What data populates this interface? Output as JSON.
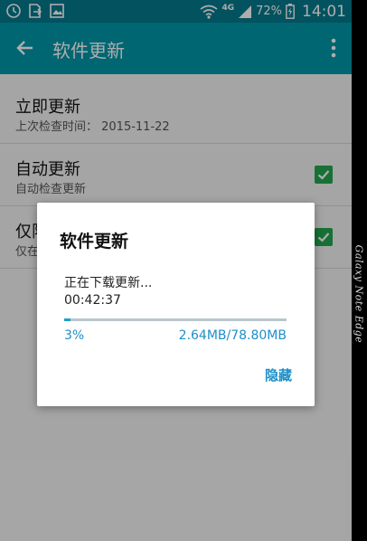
{
  "status_bar": {
    "icons": [
      "clock-icon",
      "export-icon",
      "image-icon",
      "wifi-icon",
      "signal-icon",
      "battery-icon"
    ],
    "network": "4G",
    "battery": "72%",
    "time": "14:01"
  },
  "toolbar": {
    "title": "软件更新",
    "back_icon": "arrow-left-icon",
    "menu_icon": "more-vert-icon"
  },
  "settings": [
    {
      "title": "立即更新",
      "subtitle": "上次检查时间： 2015-11-22"
    },
    {
      "title": "自动更新",
      "subtitle": "自动检查更新",
      "checked": true
    },
    {
      "title": "仅限",
      "subtitle": "仅在",
      "checked": true
    }
  ],
  "dialog": {
    "title": "软件更新",
    "message": "正在下载更新...",
    "remaining_time": "00:42:37",
    "progress_percent": 3,
    "progress_label": "3%",
    "size_label": "2.64MB/78.80MB",
    "hide_button": "隐藏"
  },
  "device": {
    "label": "Galaxy Note Edge"
  },
  "colors": {
    "status_bar": "#037a8c",
    "toolbar": "#0097a8",
    "checkbox": "#23a74d",
    "accent": "#1d8fc8"
  }
}
